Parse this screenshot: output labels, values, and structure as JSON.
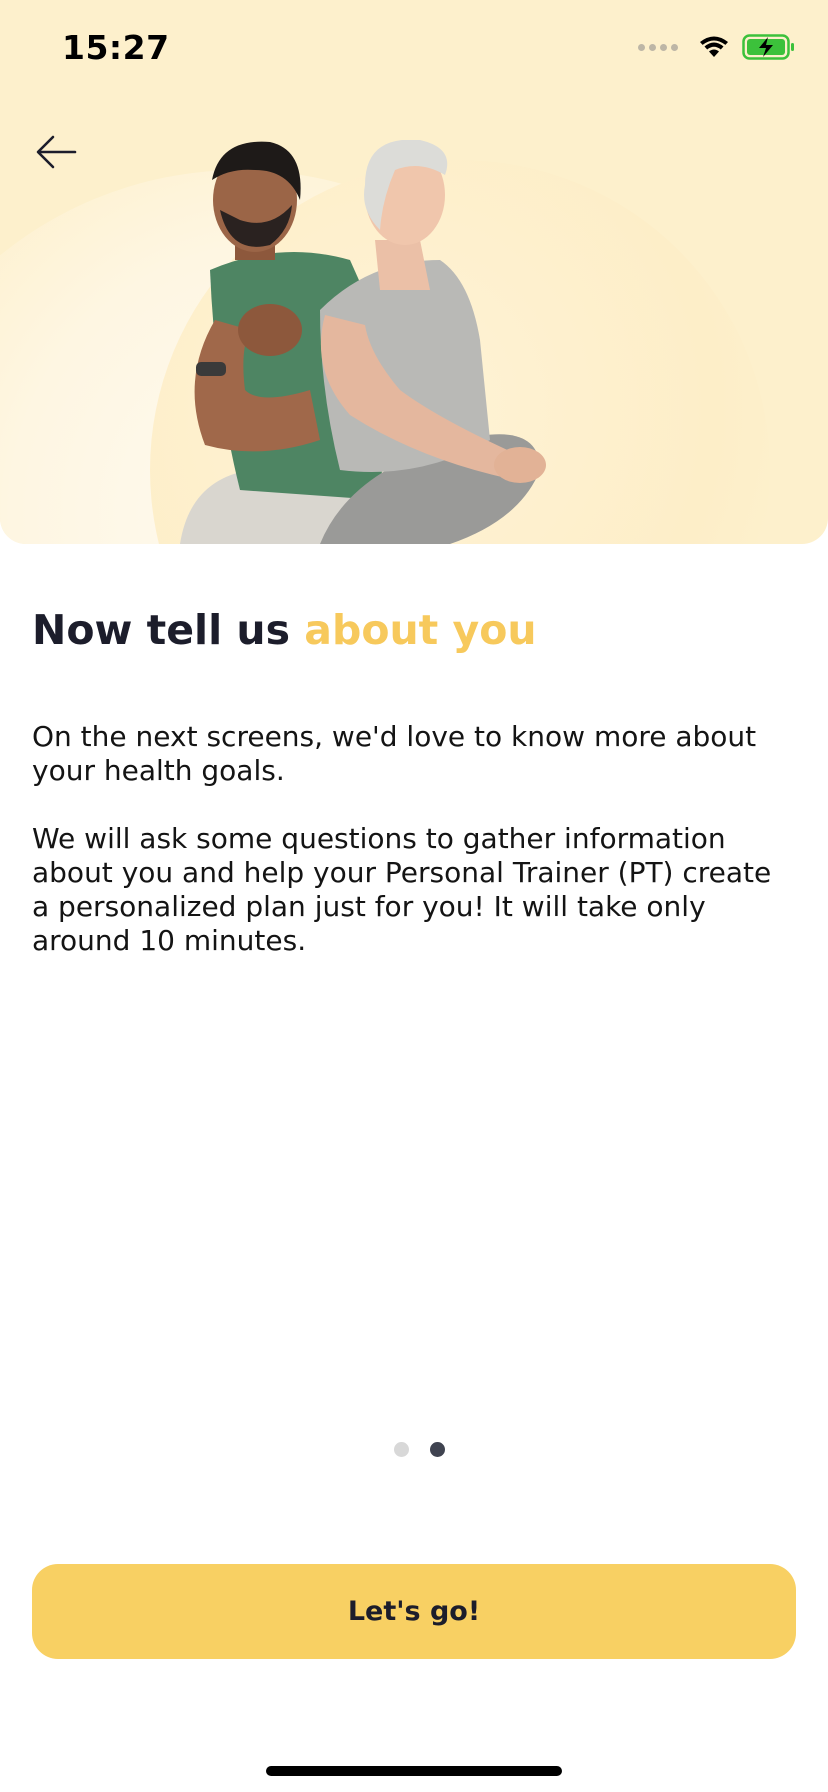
{
  "status_bar": {
    "time": "15:27",
    "icons": [
      "signal-icon",
      "wifi-icon",
      "battery-charging-icon"
    ],
    "battery_color": "#3cc13b"
  },
  "nav": {
    "back_icon": "arrow-left-icon"
  },
  "hero": {
    "background_color": "#fdf0cc",
    "illustration": "two-people-exercising-image"
  },
  "content": {
    "title_main": "Now tell us ",
    "title_accent": "about you",
    "accent_color": "#f7c95c",
    "paragraph_1": "On the next screens, we'd love to know more about your health goals.",
    "paragraph_2": "We will ask some questions to gather information about you and help your Personal Trainer (PT) create a personalized plan just for you! It will take only around 10 minutes."
  },
  "pager": {
    "total": 2,
    "active_index": 1
  },
  "cta": {
    "label": "Let's go!",
    "color": "#f8d063"
  }
}
